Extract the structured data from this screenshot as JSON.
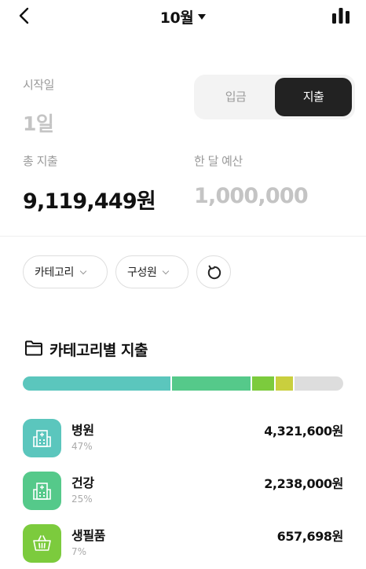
{
  "header": {
    "month": "10월",
    "back_icon": "chevron-left-icon",
    "stats_icon": "bar-chart-icon"
  },
  "period": {
    "start_label": "시작일",
    "start_value": "1일"
  },
  "type_toggle": {
    "income": "입금",
    "expense": "지출",
    "selected": "지출"
  },
  "summary": {
    "total_label": "총 지출",
    "total_value": "9,119,449원",
    "budget_label": "한 달 예산",
    "budget_value": "1,000,000"
  },
  "filters": {
    "category": "카테고리",
    "member": "구성원",
    "reset_icon": "refresh-icon"
  },
  "category_section": {
    "title": "카테고리별 지출",
    "icon": "folder-icon",
    "bar_segments": [
      {
        "fraction": 0.47,
        "color": "#5bc6bd"
      },
      {
        "fraction": 0.25,
        "color": "#55c98a"
      },
      {
        "fraction": 0.07,
        "color": "#7ccb3d"
      },
      {
        "fraction": 0.055,
        "color": "#c9cf3e"
      },
      {
        "fraction": 0.135,
        "color": "#dddddd"
      }
    ],
    "items": [
      {
        "name": "병원",
        "percent": "47%",
        "amount": "4,321,600원",
        "icon": "hospital-icon",
        "color": "#5bc6bd"
      },
      {
        "name": "건강",
        "percent": "25%",
        "amount": "2,238,000원",
        "icon": "hospital-icon",
        "color": "#55c98a"
      },
      {
        "name": "생필품",
        "percent": "7%",
        "amount": "657,698원",
        "icon": "basket-icon",
        "color": "#7ccb3d"
      }
    ]
  }
}
